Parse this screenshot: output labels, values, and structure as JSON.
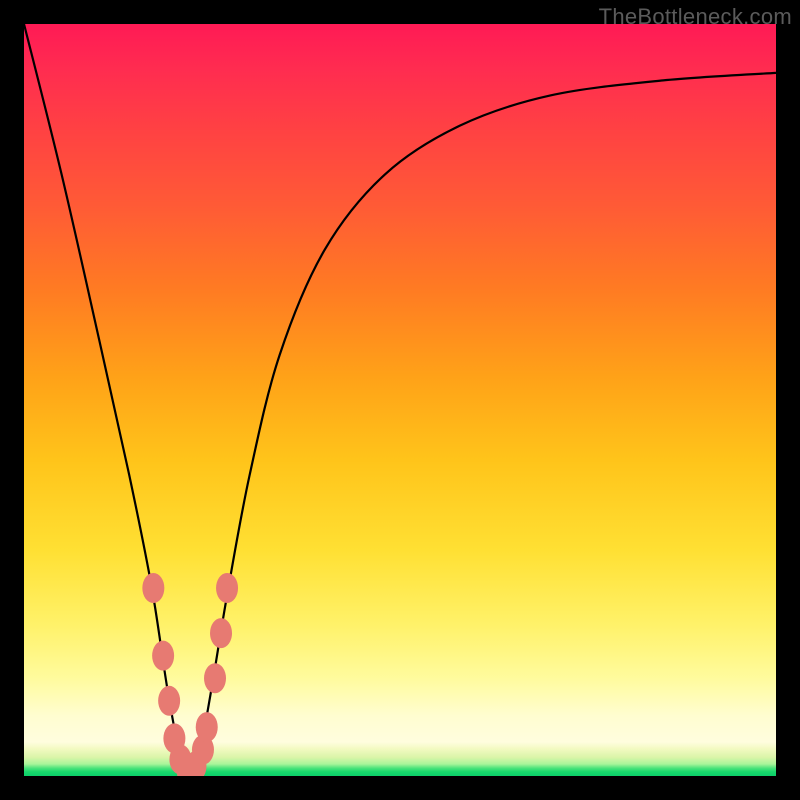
{
  "watermark": "TheBottleneck.com",
  "colors": {
    "frame": "#000000",
    "curve": "#000000",
    "marker_fill": "#e77a72",
    "marker_stroke": "#c9615a"
  },
  "chart_data": {
    "type": "line",
    "title": "",
    "xlabel": "",
    "ylabel": "",
    "xlim": [
      0,
      100
    ],
    "ylim": [
      0,
      100
    ],
    "grid": false,
    "x": [
      0,
      5,
      10,
      14,
      17,
      19,
      20.5,
      22,
      23.5,
      25,
      27,
      30,
      34,
      40,
      48,
      58,
      70,
      85,
      100
    ],
    "values": [
      100,
      80,
      58,
      40,
      25,
      12,
      4,
      0,
      4,
      12,
      24,
      40,
      56,
      70,
      80,
      86.5,
      90.5,
      92.5,
      93.5
    ],
    "markers": [
      {
        "x": 17.2,
        "y": 25
      },
      {
        "x": 18.5,
        "y": 16
      },
      {
        "x": 19.3,
        "y": 10
      },
      {
        "x": 20.0,
        "y": 5
      },
      {
        "x": 20.8,
        "y": 2.2
      },
      {
        "x": 21.8,
        "y": 0.5
      },
      {
        "x": 22.8,
        "y": 1.3
      },
      {
        "x": 23.8,
        "y": 3.5
      },
      {
        "x": 24.3,
        "y": 6.5
      },
      {
        "x": 25.4,
        "y": 13
      },
      {
        "x": 26.2,
        "y": 19
      },
      {
        "x": 27.0,
        "y": 25
      }
    ]
  }
}
